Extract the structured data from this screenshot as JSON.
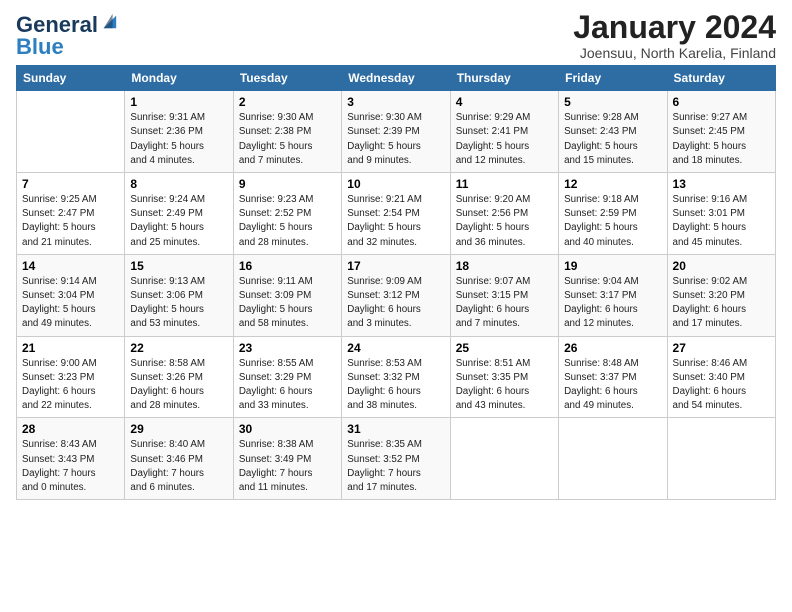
{
  "logo": {
    "line1": "General",
    "line2": "Blue"
  },
  "title": "January 2024",
  "location": "Joensuu, North Karelia, Finland",
  "days_of_week": [
    "Sunday",
    "Monday",
    "Tuesday",
    "Wednesday",
    "Thursday",
    "Friday",
    "Saturday"
  ],
  "weeks": [
    [
      {
        "num": "",
        "info": ""
      },
      {
        "num": "1",
        "info": "Sunrise: 9:31 AM\nSunset: 2:36 PM\nDaylight: 5 hours\nand 4 minutes."
      },
      {
        "num": "2",
        "info": "Sunrise: 9:30 AM\nSunset: 2:38 PM\nDaylight: 5 hours\nand 7 minutes."
      },
      {
        "num": "3",
        "info": "Sunrise: 9:30 AM\nSunset: 2:39 PM\nDaylight: 5 hours\nand 9 minutes."
      },
      {
        "num": "4",
        "info": "Sunrise: 9:29 AM\nSunset: 2:41 PM\nDaylight: 5 hours\nand 12 minutes."
      },
      {
        "num": "5",
        "info": "Sunrise: 9:28 AM\nSunset: 2:43 PM\nDaylight: 5 hours\nand 15 minutes."
      },
      {
        "num": "6",
        "info": "Sunrise: 9:27 AM\nSunset: 2:45 PM\nDaylight: 5 hours\nand 18 minutes."
      }
    ],
    [
      {
        "num": "7",
        "info": "Sunrise: 9:25 AM\nSunset: 2:47 PM\nDaylight: 5 hours\nand 21 minutes."
      },
      {
        "num": "8",
        "info": "Sunrise: 9:24 AM\nSunset: 2:49 PM\nDaylight: 5 hours\nand 25 minutes."
      },
      {
        "num": "9",
        "info": "Sunrise: 9:23 AM\nSunset: 2:52 PM\nDaylight: 5 hours\nand 28 minutes."
      },
      {
        "num": "10",
        "info": "Sunrise: 9:21 AM\nSunset: 2:54 PM\nDaylight: 5 hours\nand 32 minutes."
      },
      {
        "num": "11",
        "info": "Sunrise: 9:20 AM\nSunset: 2:56 PM\nDaylight: 5 hours\nand 36 minutes."
      },
      {
        "num": "12",
        "info": "Sunrise: 9:18 AM\nSunset: 2:59 PM\nDaylight: 5 hours\nand 40 minutes."
      },
      {
        "num": "13",
        "info": "Sunrise: 9:16 AM\nSunset: 3:01 PM\nDaylight: 5 hours\nand 45 minutes."
      }
    ],
    [
      {
        "num": "14",
        "info": "Sunrise: 9:14 AM\nSunset: 3:04 PM\nDaylight: 5 hours\nand 49 minutes."
      },
      {
        "num": "15",
        "info": "Sunrise: 9:13 AM\nSunset: 3:06 PM\nDaylight: 5 hours\nand 53 minutes."
      },
      {
        "num": "16",
        "info": "Sunrise: 9:11 AM\nSunset: 3:09 PM\nDaylight: 5 hours\nand 58 minutes."
      },
      {
        "num": "17",
        "info": "Sunrise: 9:09 AM\nSunset: 3:12 PM\nDaylight: 6 hours\nand 3 minutes."
      },
      {
        "num": "18",
        "info": "Sunrise: 9:07 AM\nSunset: 3:15 PM\nDaylight: 6 hours\nand 7 minutes."
      },
      {
        "num": "19",
        "info": "Sunrise: 9:04 AM\nSunset: 3:17 PM\nDaylight: 6 hours\nand 12 minutes."
      },
      {
        "num": "20",
        "info": "Sunrise: 9:02 AM\nSunset: 3:20 PM\nDaylight: 6 hours\nand 17 minutes."
      }
    ],
    [
      {
        "num": "21",
        "info": "Sunrise: 9:00 AM\nSunset: 3:23 PM\nDaylight: 6 hours\nand 22 minutes."
      },
      {
        "num": "22",
        "info": "Sunrise: 8:58 AM\nSunset: 3:26 PM\nDaylight: 6 hours\nand 28 minutes."
      },
      {
        "num": "23",
        "info": "Sunrise: 8:55 AM\nSunset: 3:29 PM\nDaylight: 6 hours\nand 33 minutes."
      },
      {
        "num": "24",
        "info": "Sunrise: 8:53 AM\nSunset: 3:32 PM\nDaylight: 6 hours\nand 38 minutes."
      },
      {
        "num": "25",
        "info": "Sunrise: 8:51 AM\nSunset: 3:35 PM\nDaylight: 6 hours\nand 43 minutes."
      },
      {
        "num": "26",
        "info": "Sunrise: 8:48 AM\nSunset: 3:37 PM\nDaylight: 6 hours\nand 49 minutes."
      },
      {
        "num": "27",
        "info": "Sunrise: 8:46 AM\nSunset: 3:40 PM\nDaylight: 6 hours\nand 54 minutes."
      }
    ],
    [
      {
        "num": "28",
        "info": "Sunrise: 8:43 AM\nSunset: 3:43 PM\nDaylight: 7 hours\nand 0 minutes."
      },
      {
        "num": "29",
        "info": "Sunrise: 8:40 AM\nSunset: 3:46 PM\nDaylight: 7 hours\nand 6 minutes."
      },
      {
        "num": "30",
        "info": "Sunrise: 8:38 AM\nSunset: 3:49 PM\nDaylight: 7 hours\nand 11 minutes."
      },
      {
        "num": "31",
        "info": "Sunrise: 8:35 AM\nSunset: 3:52 PM\nDaylight: 7 hours\nand 17 minutes."
      },
      {
        "num": "",
        "info": ""
      },
      {
        "num": "",
        "info": ""
      },
      {
        "num": "",
        "info": ""
      }
    ]
  ]
}
